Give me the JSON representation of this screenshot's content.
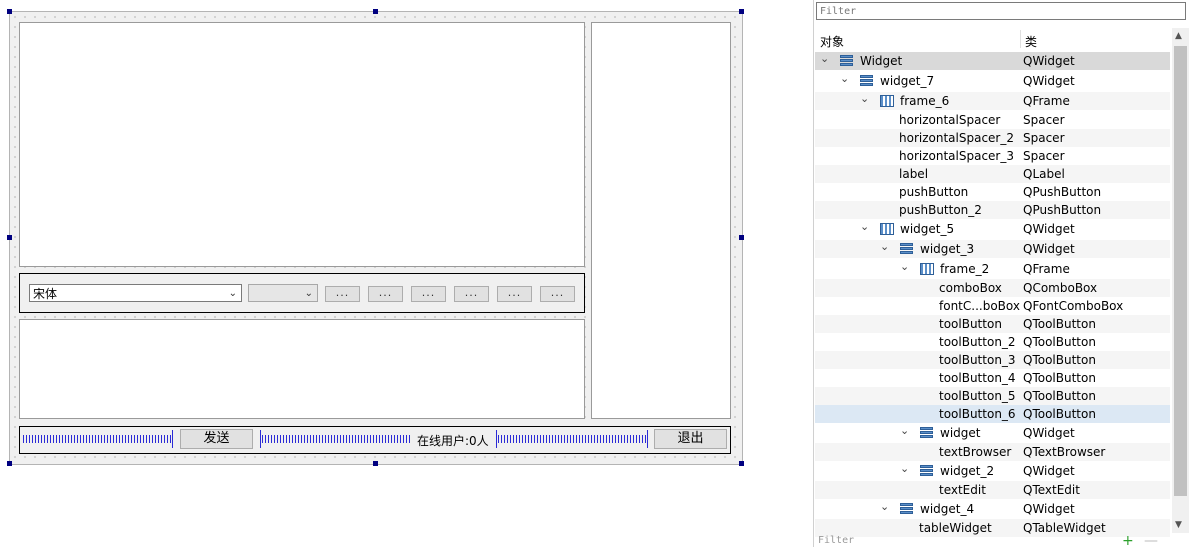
{
  "form": {
    "font_combo_value": "宋体",
    "tool_buttons": [
      "...",
      "...",
      "...",
      "...",
      "...",
      "..."
    ],
    "send_button": "发送",
    "online_label": "在线用户:0人",
    "exit_button": "退出"
  },
  "inspector": {
    "filter_placeholder": "Filter",
    "header_object": "对象",
    "header_class": "类",
    "rows": [
      {
        "name": "Widget",
        "cls": "QWidget"
      },
      {
        "name": "widget_7",
        "cls": "QWidget"
      },
      {
        "name": "frame_6",
        "cls": "QFrame"
      },
      {
        "name": "horizontalSpacer",
        "cls": "Spacer"
      },
      {
        "name": "horizontalSpacer_2",
        "cls": "Spacer"
      },
      {
        "name": "horizontalSpacer_3",
        "cls": "Spacer"
      },
      {
        "name": "label",
        "cls": "QLabel"
      },
      {
        "name": "pushButton",
        "cls": "QPushButton"
      },
      {
        "name": "pushButton_2",
        "cls": "QPushButton"
      },
      {
        "name": "widget_5",
        "cls": "QWidget"
      },
      {
        "name": "widget_3",
        "cls": "QWidget"
      },
      {
        "name": "frame_2",
        "cls": "QFrame"
      },
      {
        "name": "comboBox",
        "cls": "QComboBox"
      },
      {
        "name": "fontC...boBox",
        "cls": "QFontComboBox"
      },
      {
        "name": "toolButton",
        "cls": "QToolButton"
      },
      {
        "name": "toolButton_2",
        "cls": "QToolButton"
      },
      {
        "name": "toolButton_3",
        "cls": "QToolButton"
      },
      {
        "name": "toolButton_4",
        "cls": "QToolButton"
      },
      {
        "name": "toolButton_5",
        "cls": "QToolButton"
      },
      {
        "name": "toolButton_6",
        "cls": "QToolButton"
      },
      {
        "name": "widget",
        "cls": "QWidget"
      },
      {
        "name": "textBrowser",
        "cls": "QTextBrowser"
      },
      {
        "name": "widget_2",
        "cls": "QWidget"
      },
      {
        "name": "textEdit",
        "cls": "QTextEdit"
      },
      {
        "name": "widget_4",
        "cls": "QWidget"
      },
      {
        "name": "tableWidget",
        "cls": "QTableWidget"
      }
    ],
    "bottom_filter": "Filter"
  }
}
